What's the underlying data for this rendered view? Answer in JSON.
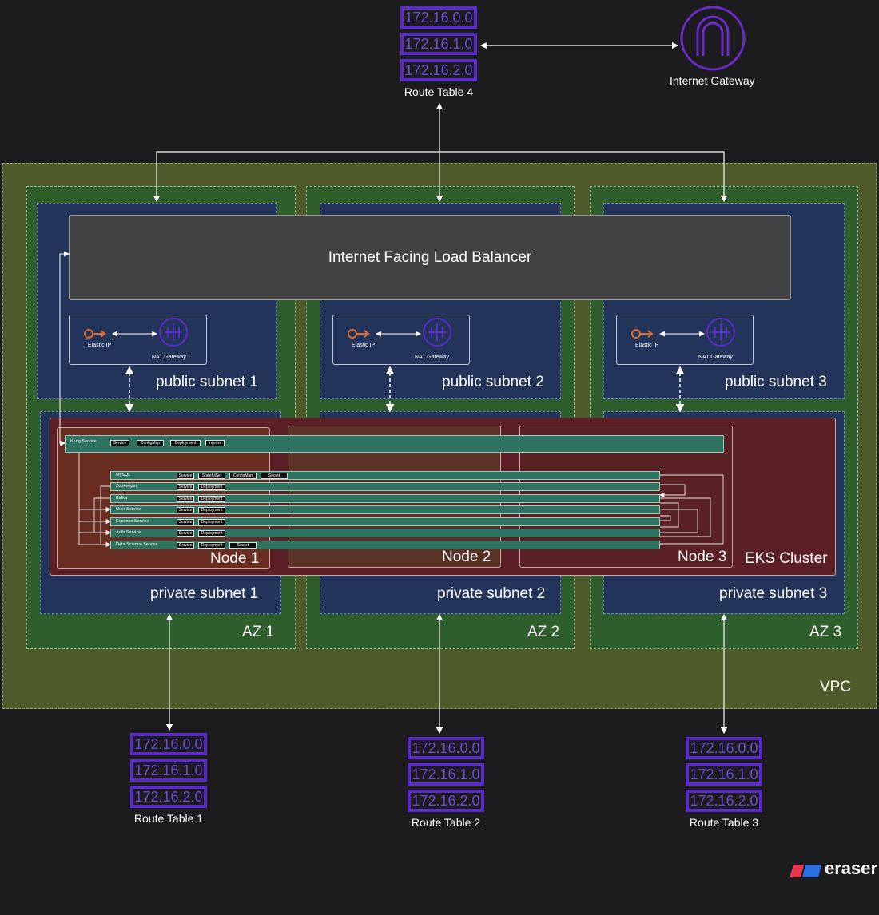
{
  "route_table_top": {
    "cidrs": [
      "172.16.0.0",
      "172.16.1.0",
      "172.16.2.0"
    ],
    "caption": "Route Table 4"
  },
  "route_tables_bottom": [
    {
      "cidrs": [
        "172.16.0.0",
        "172.16.1.0",
        "172.16.2.0"
      ],
      "caption": "Route Table 1"
    },
    {
      "cidrs": [
        "172.16.0.0",
        "172.16.1.0",
        "172.16.2.0"
      ],
      "caption": "Route Table 2"
    },
    {
      "cidrs": [
        "172.16.0.0",
        "172.16.1.0",
        "172.16.2.0"
      ],
      "caption": "Route Table 3"
    }
  ],
  "internet_gateway": {
    "label": "Internet Gateway"
  },
  "vpc": {
    "label": "VPC"
  },
  "azs": [
    "AZ 1",
    "AZ 2",
    "AZ 3"
  ],
  "public_subnets": [
    "public subnet 1",
    "public subnet 2",
    "public subnet 3"
  ],
  "private_subnets": [
    "private subnet 1",
    "private subnet 2",
    "private subnet 3"
  ],
  "load_balancer": {
    "label": "Internet Facing Load Balancer"
  },
  "nat_box": {
    "elastic_ip": "Elastic IP",
    "nat_gateway": "NAT Gateway"
  },
  "eks": {
    "label": "EKS Cluster",
    "nodes": [
      "Node 1",
      "Node 2",
      "Node 3"
    ]
  },
  "kong": {
    "name": "Kong Service",
    "tags": [
      "Service",
      "ConfigMap",
      "Deployment",
      "Ingress"
    ]
  },
  "services": [
    {
      "name": "MySQL",
      "tags": [
        "Service",
        "StatefulSet",
        "ConfigMap",
        "Secret"
      ]
    },
    {
      "name": "Zookeeper",
      "tags": [
        "Service",
        "Deployment"
      ]
    },
    {
      "name": "Kafka",
      "tags": [
        "Service",
        "Deployment"
      ]
    },
    {
      "name": "User Service",
      "tags": [
        "Service",
        "Deployment"
      ]
    },
    {
      "name": "Expense Service",
      "tags": [
        "Service",
        "Deployment"
      ]
    },
    {
      "name": "Auth Service",
      "tags": [
        "Service",
        "Deployment"
      ]
    },
    {
      "name": "Data Science Service",
      "tags": [
        "Service",
        "Deployment",
        "Secret"
      ]
    }
  ],
  "brand": {
    "name": "eraser"
  },
  "colors": {
    "route_table": "#5a2bc9",
    "gateway": "#6a2bc9",
    "vpc": "#4f5a2a",
    "az": "#2d5e2c",
    "subnet": "#22345a",
    "eks": "#5c1f26",
    "service_row": "#2e7261",
    "elastic_ip": "#e0692b"
  }
}
